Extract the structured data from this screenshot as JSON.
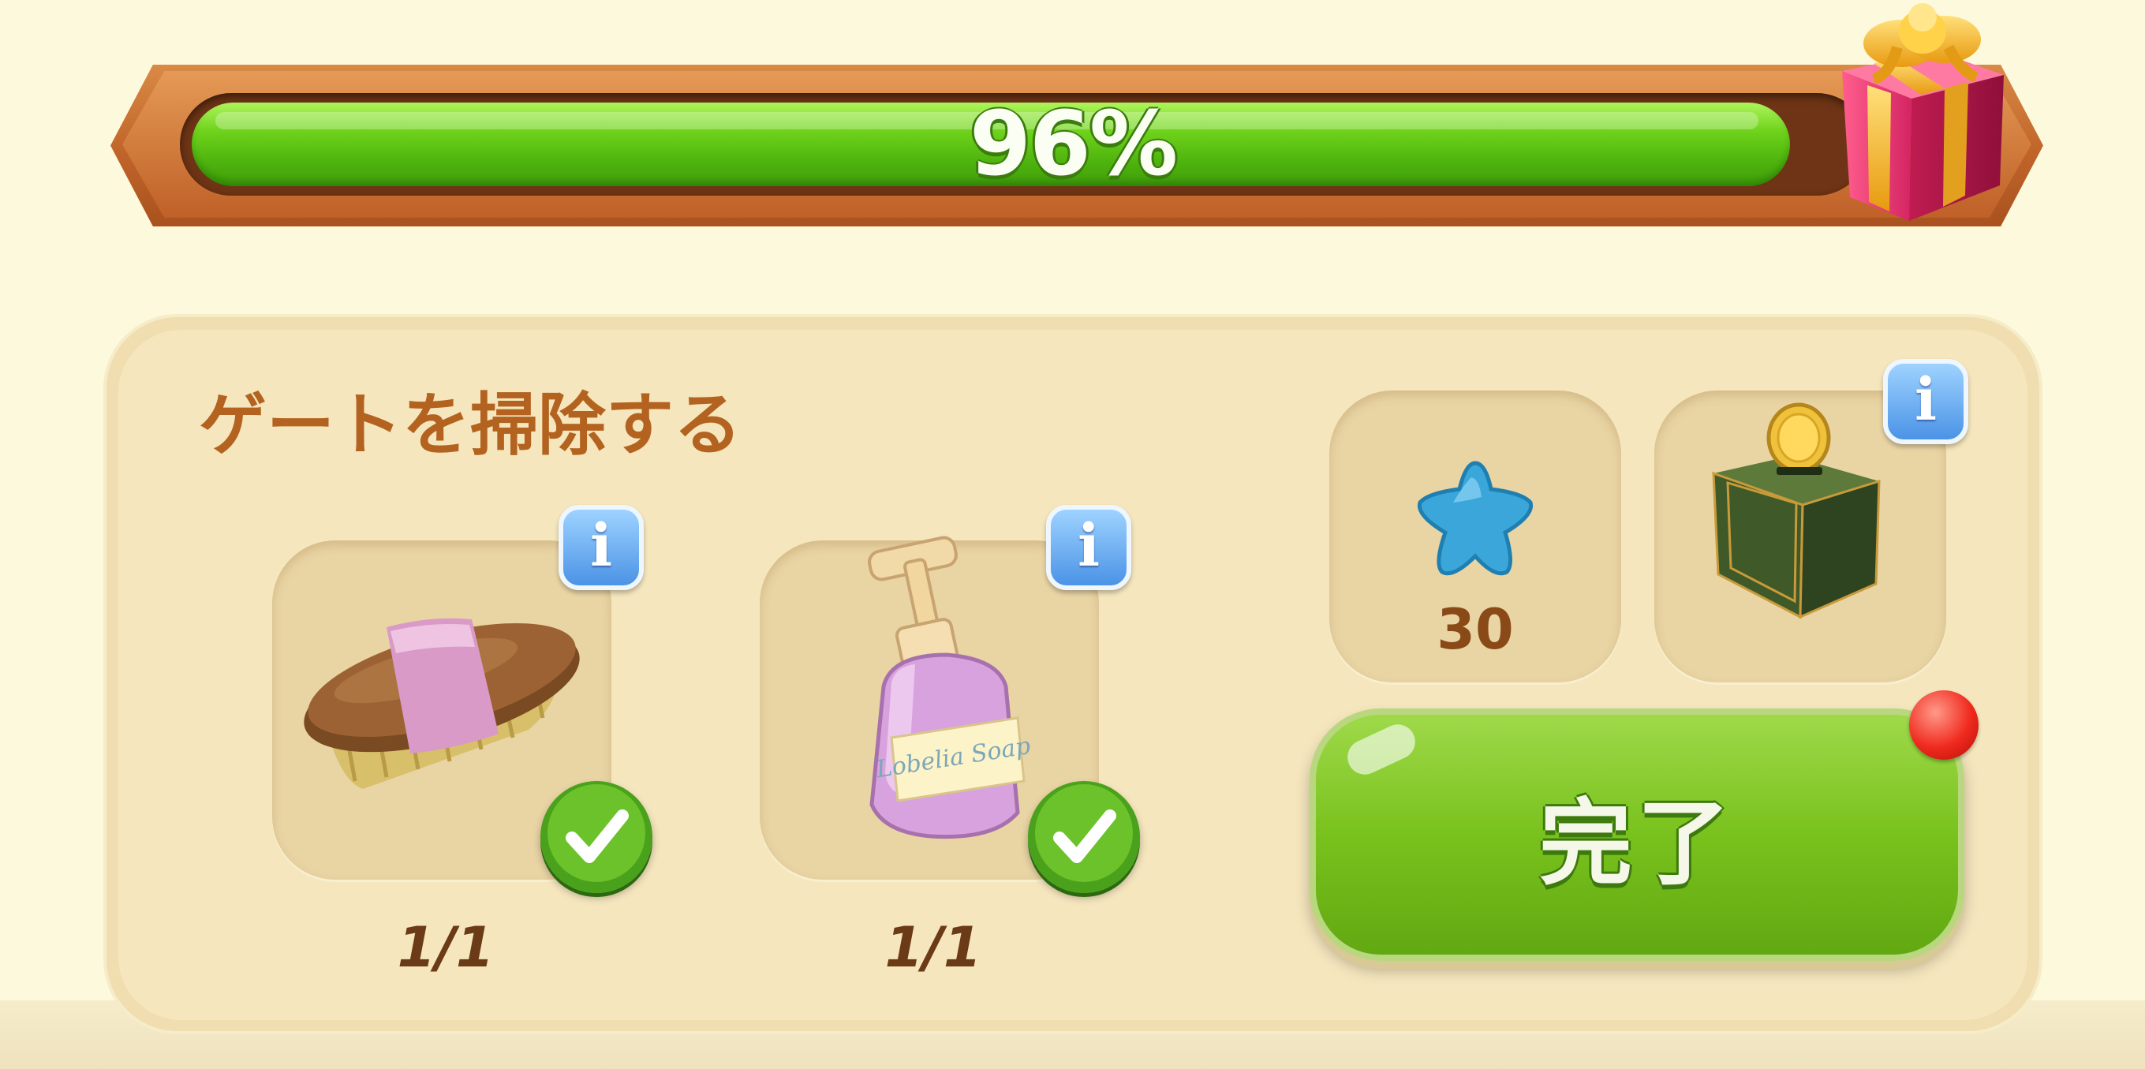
{
  "progress": {
    "percent_label": "96%",
    "value": 0.96
  },
  "task": {
    "title": "ゲートを掃除する",
    "items": [
      {
        "name": "brush",
        "icon": "scrub-brush-icon",
        "count": "1/1",
        "completed": true
      },
      {
        "name": "soap",
        "icon": "soap-bottle-icon",
        "count": "1/1",
        "completed": true
      }
    ],
    "rewards": [
      {
        "icon": "blue-star-icon",
        "count": "30"
      },
      {
        "icon": "coin-bank-box-icon",
        "count": ""
      }
    ],
    "done_label": "完了"
  },
  "info_label": "i",
  "colors": {
    "progress_green": "#6ed21b",
    "frame_orange": "#c0642a",
    "title_brown": "#b3631f",
    "button_green": "#79c21d",
    "info_blue": "#4b93e6",
    "notification_red": "#f02a1e"
  }
}
